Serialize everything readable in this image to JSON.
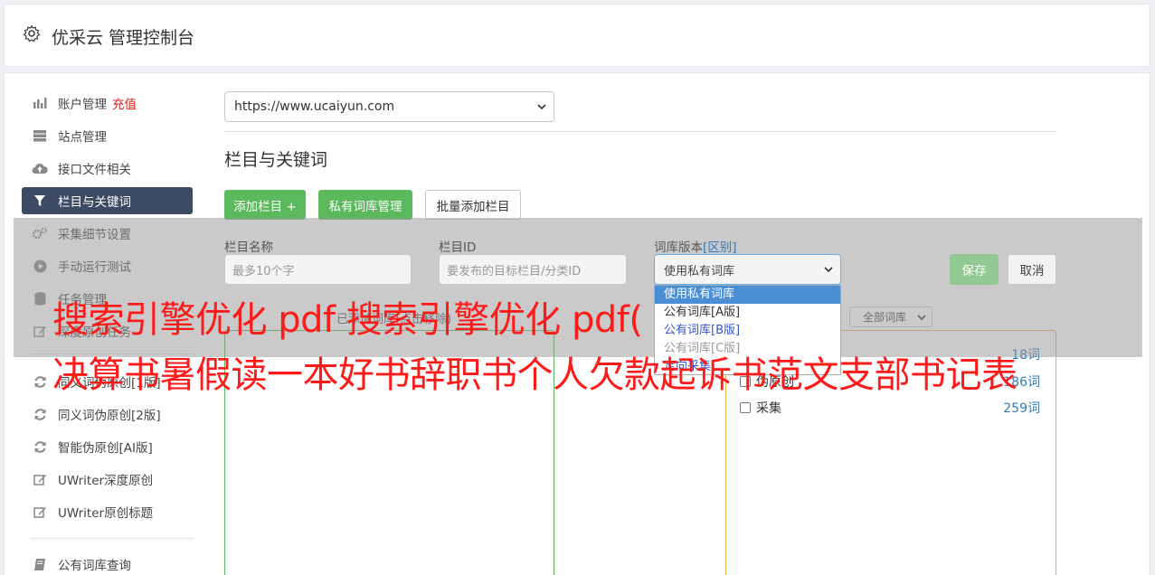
{
  "header": {
    "title": "优采云 管理控制台"
  },
  "sidebar": {
    "items": [
      {
        "label": "账户管理",
        "badge": "充值",
        "icon": "bar-chart-icon"
      },
      {
        "label": "站点管理",
        "icon": "server-icon"
      },
      {
        "label": "接口文件相关",
        "icon": "cloud-upload-icon"
      },
      {
        "label": "栏目与关键词",
        "icon": "filter-icon",
        "active": true
      },
      {
        "label": "采集细节设置",
        "icon": "cogs-icon"
      },
      {
        "label": "手动运行测试",
        "icon": "play-circle-icon"
      },
      {
        "label": "任务管理",
        "icon": "database-icon"
      },
      {
        "label": "深度原创任务",
        "icon": "edit-icon"
      },
      {
        "label": "同义词伪原创[1版]",
        "icon": "refresh-icon"
      },
      {
        "label": "同义词伪原创[2版]",
        "icon": "refresh-icon"
      },
      {
        "label": "智能伪原创[AI版]",
        "icon": "refresh-icon"
      },
      {
        "label": "UWriter深度原创",
        "icon": "edit-icon"
      },
      {
        "label": "UWriter原创标题",
        "icon": "edit-icon"
      },
      {
        "label": "公有词库查询",
        "icon": "book-icon"
      }
    ]
  },
  "main": {
    "site_select": "https://www.ucaiyun.com",
    "section_title": "栏目与关键词",
    "buttons": {
      "add": "添加栏目 +",
      "private": "私有词库管理",
      "batch": "批量添加栏目"
    },
    "form": {
      "name_label": "栏目名称",
      "name_placeholder": "最多10个字",
      "id_label": "栏目ID",
      "id_placeholder": "要发布的目标栏目/分类ID",
      "version_label": "词库版本",
      "version_hint": "[区别]",
      "version_value": "使用私有词库",
      "save": "保存",
      "cancel": "取消"
    },
    "dropdown": {
      "options": [
        "使用私有词库",
        "公有词库[A版]",
        "公有词库[B版]",
        "公有词库[C版]",
        "定向采集"
      ]
    },
    "left_hint": "已添加词库(点击移除)",
    "all_select": "全部词库",
    "libraries": [
      {
        "name": "",
        "count": "18词"
      },
      {
        "name": "伪原创",
        "count": "186词"
      },
      {
        "name": "采集",
        "count": "259词"
      }
    ]
  },
  "watermark": {
    "line1": "搜索引擎优化 pdf 搜索引擎优化 pdf(",
    "line2": "决算书暑假读一本好书辞职书个人欠款起诉书范文支部书记表"
  },
  "colors": {
    "accent": "#5cb85c",
    "active_nav": "#3c4a63",
    "recharge": "#e02020",
    "watermark": "#ff1a1a"
  }
}
